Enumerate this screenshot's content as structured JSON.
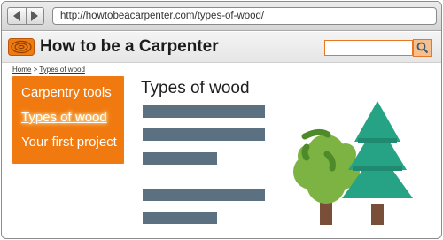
{
  "browser": {
    "url": "http://howtobeacarpenter.com/types-of-wood/"
  },
  "site": {
    "title": "How to be a Carpenter",
    "search_placeholder": ""
  },
  "breadcrumb": {
    "home": "Home",
    "separator": ">",
    "current": "Types of wood"
  },
  "sidebar": {
    "items": [
      {
        "label": "Carpentry tools",
        "active": false
      },
      {
        "label": "Types of wood",
        "active": true
      },
      {
        "label": "Your first project",
        "active": false
      }
    ]
  },
  "main": {
    "title": "Types of wood",
    "placeholder_lines": 5,
    "illustration": "trees"
  },
  "colors": {
    "accent": "#f07a10",
    "text_placeholder": "#5b7182",
    "tree_green_light": "#7cb342",
    "tree_green_teal": "#26a385",
    "trunk": "#7a4f3a"
  }
}
